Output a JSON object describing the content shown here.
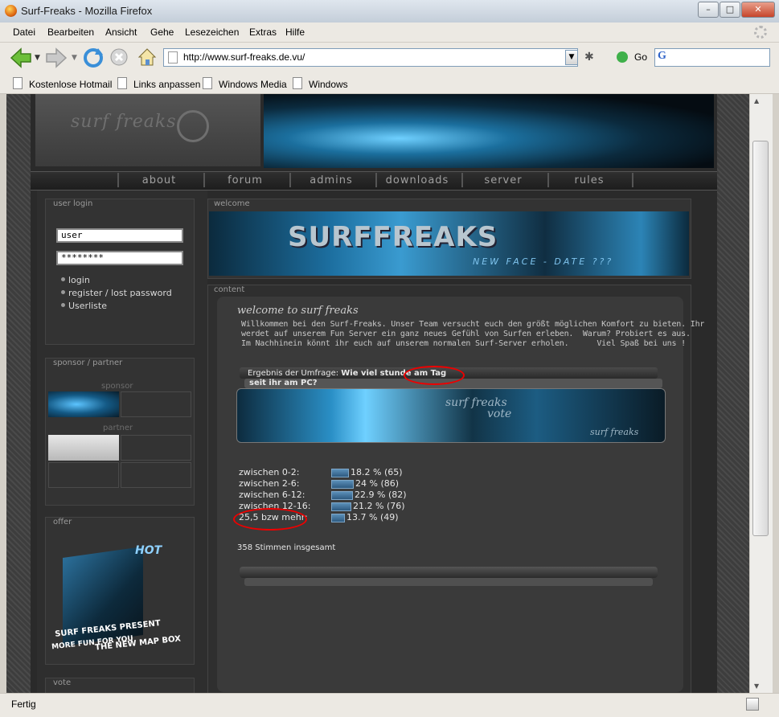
{
  "window": {
    "title": "Surf-Freaks - Mozilla Firefox",
    "min_label": "–",
    "max_label": "□",
    "close_label": "✕"
  },
  "menu": [
    "Datei",
    "Bearbeiten",
    "Ansicht",
    "Gehe",
    "Lesezeichen",
    "Extras",
    "Hilfe"
  ],
  "toolbar": {
    "url": "http://www.surf-freaks.de.vu/",
    "go_label": "Go",
    "search_value": ""
  },
  "bookmarks": [
    "Kostenlose Hotmail",
    "Links anpassen",
    "Windows Media",
    "Windows"
  ],
  "status": {
    "text": "Fertig"
  },
  "site": {
    "logo": "surf freaks",
    "nav": [
      "about",
      "forum",
      "admins",
      "downloads",
      "server",
      "rules"
    ],
    "user_login": {
      "title": "user login",
      "username_value": "user",
      "password_value": "********",
      "links": [
        "login",
        "register / lost password",
        "Userliste"
      ]
    },
    "sponsor": {
      "title": "sponsor / partner",
      "sponsor_label": "sponsor",
      "partner_label": "partner"
    },
    "offer": {
      "title": "offer",
      "badge": "HOT",
      "box_line1": "SURF FREAKS PRESENT",
      "box_line2": "THE NEW MAP BOX",
      "box_line3": "MORE FUN FOR YOU"
    },
    "vote_title": "vote",
    "welcome": {
      "title": "welcome",
      "logo": "SURFFREAKS",
      "tagline": "NEW FACE - DATE ???"
    },
    "content": {
      "title": "content",
      "heading": "welcome to surf freaks",
      "p1": "Willkommen bei den Surf-Freaks. Unser Team versucht euch den größt möglichen Komfort zu bieten. Ihr",
      "p2": "werdet auf unserem Fun Server ein ganz neues Gefühl von Surfen erleben.  Warum? Probiert es aus.",
      "p3": "Im Nachhinein könnt ihr euch auf unserem normalen Surf-Server erholen.      Viel Spaß bei uns !"
    },
    "poll": {
      "result_prefix": "Ergebnis der Umfrage: ",
      "question_part1": "Wie viel stunde am Tag",
      "question_part2": "seit ihr am PC?",
      "image_text1": "surf freaks",
      "image_text2": "vote",
      "image_text3": "surf freaks",
      "rows": [
        {
          "label": "zwischen 0-2:",
          "result": "18.2 % (65)",
          "percent": 18.2
        },
        {
          "label": "zwischen 2-6:",
          "result": "24 % (86)",
          "percent": 24
        },
        {
          "label": "zwischen 6-12:",
          "result": "22.9 % (82)",
          "percent": 22.9
        },
        {
          "label": "zwischen 12-16:",
          "result": "21.2 % (76)",
          "percent": 21.2
        },
        {
          "label": "25,5 bzw mehr:",
          "result": "13.7 % (49)",
          "percent": 13.7
        }
      ],
      "total": "358 Stimmen insgesamt"
    },
    "colors": {
      "annotation": "#e00000",
      "bar": "#4a7ea8"
    }
  }
}
